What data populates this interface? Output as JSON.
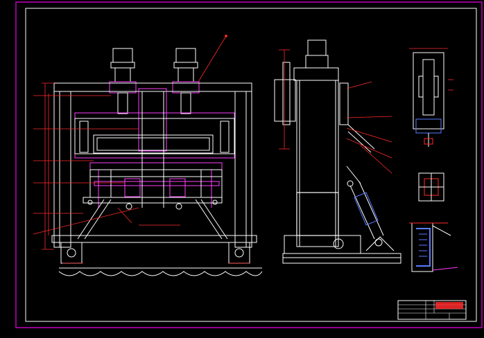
{
  "drawing": {
    "background": "#000000",
    "colors": {
      "outline": "#ffffff",
      "frame": "#c000c0",
      "dimension": "#ff2a2a",
      "member": "#ff40ff",
      "cylinder": "#5a7bff",
      "hatch": "#c8c8c8"
    }
  },
  "title_block": {
    "drawing_name": "",
    "rows": [
      "",
      "",
      "",
      ""
    ]
  }
}
